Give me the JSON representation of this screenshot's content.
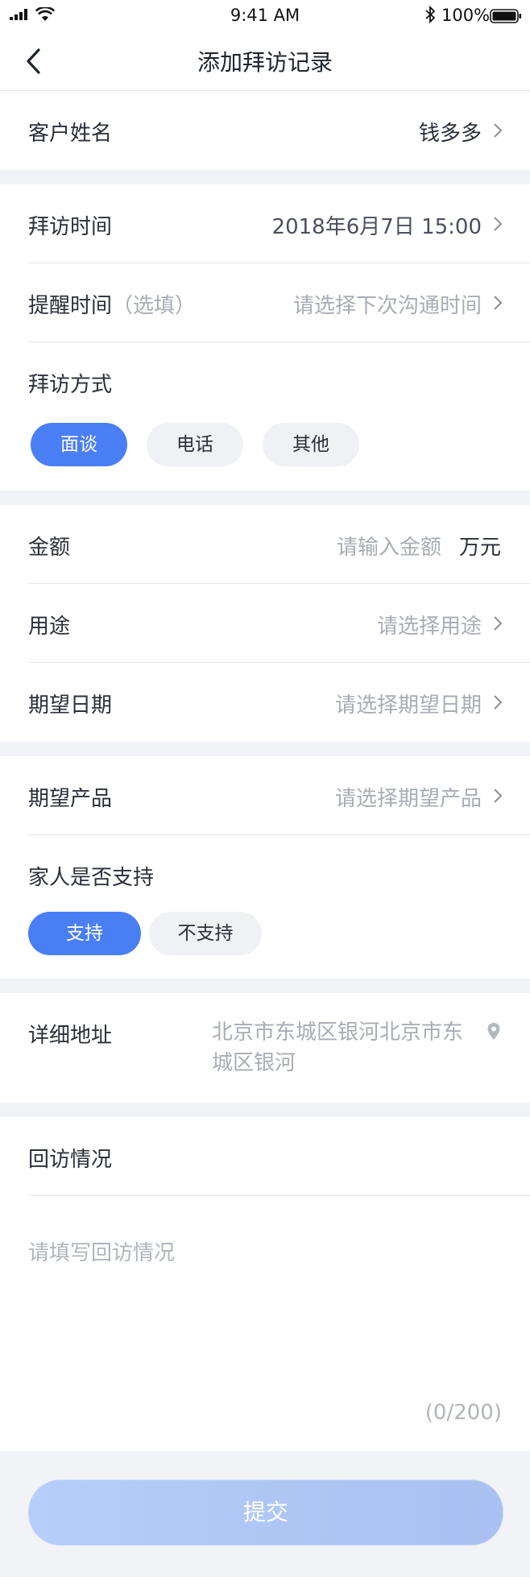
{
  "status_bar": {
    "time": "9:41 AM",
    "battery": "100%"
  },
  "nav": {
    "title": "添加拜访记录"
  },
  "customer": {
    "label": "客户姓名",
    "value": "钱多多"
  },
  "visit_time": {
    "label": "拜访时间",
    "value": "2018年6月7日 15:00"
  },
  "reminder": {
    "label": "提醒时间",
    "hint": "（选填）",
    "placeholder": "请选择下次沟通时间"
  },
  "visit_method": {
    "label": "拜访方式",
    "options": [
      "面谈",
      "电话",
      "其他"
    ],
    "selected": "面谈"
  },
  "amount": {
    "label": "金额",
    "placeholder": "请输入金额",
    "unit": "万元"
  },
  "purpose": {
    "label": "用途",
    "placeholder": "请选择用途"
  },
  "expected_date": {
    "label": "期望日期",
    "placeholder": "请选择期望日期"
  },
  "expected_product": {
    "label": "期望产品",
    "placeholder": "请选择期望产品"
  },
  "family_support": {
    "label": "家人是否支持",
    "options": [
      "支持",
      "不支持"
    ],
    "selected": "支持"
  },
  "address": {
    "label": "详细地址",
    "value_line1": "北京市东城区银河北京市东",
    "value_line2": "城区银河"
  },
  "revisit": {
    "label": "回访情况",
    "placeholder": "请填写回访情况",
    "counter": "(0/200)"
  },
  "submit": {
    "label": "提交"
  },
  "colors": {
    "accent": "#4a7ef5",
    "muted_text": "#a8acb5",
    "background": "#f2f3f7"
  }
}
